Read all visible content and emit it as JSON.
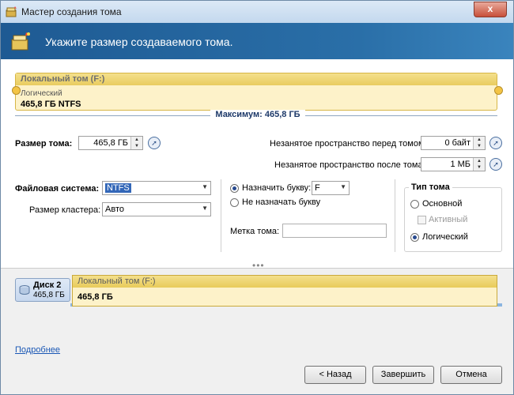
{
  "window": {
    "title": "Мастер создания тома",
    "close_glyph": "x"
  },
  "header": {
    "title": "Укажите размер создаваемого тома."
  },
  "volume_strip": {
    "name": "Локальный том (F:)",
    "type": "Логический",
    "info": "465,8 ГБ NTFS",
    "max_label": "Максимум: 465,8 ГБ"
  },
  "size": {
    "label": "Размер тома:",
    "value": "465,8 ГБ",
    "free_before_label": "Незанятое пространство перед томом:",
    "free_before_value": "0 байт",
    "free_after_label": "Незанятое пространство после тома:",
    "free_after_value": "1 МБ"
  },
  "filesystem": {
    "label": "Файловая система:",
    "value": "NTFS",
    "cluster_label": "Размер кластера:",
    "cluster_value": "Авто"
  },
  "letter": {
    "assign_label": "Назначить букву:",
    "assign_value": "F",
    "no_assign_label": "Не назначать букву",
    "volume_label_label": "Метка тома:",
    "volume_label_value": ""
  },
  "volume_type": {
    "title": "Тип тома",
    "primary": "Основной",
    "active": "Активный",
    "logical": "Логический"
  },
  "disk": {
    "name": "Диск 2",
    "size": "465,8 ГБ",
    "volume_name": "Локальный том (F:)",
    "volume_size": "465,8 ГБ"
  },
  "footer": {
    "more_link": "Подробнее",
    "back": "< Назад",
    "finish": "Завершить",
    "cancel": "Отмена"
  },
  "icons": {
    "app": "wizard-disk-icon",
    "header": "wizard-disk-icon",
    "go": "arrow-circle-icon",
    "disk": "disk-icon"
  },
  "colors": {
    "header_bg": "#1e5a93",
    "volume_fill": "#fdf2c9",
    "volume_border": "#d7b646",
    "link": "#1a57b5"
  }
}
